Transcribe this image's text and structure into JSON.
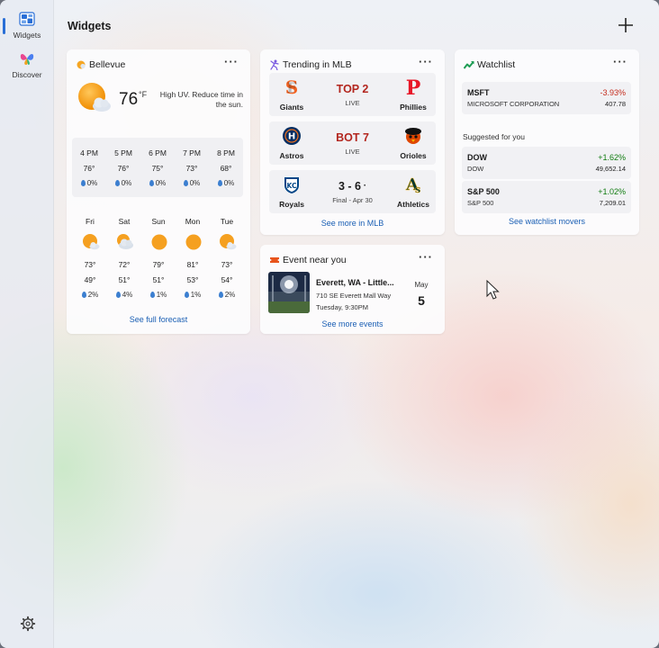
{
  "rail": {
    "widgets_label": "Widgets",
    "discover_label": "Discover"
  },
  "header": {
    "title": "Widgets"
  },
  "weather": {
    "location": "Bellevue",
    "temperature": "76",
    "unit": "°F",
    "description": "High UV. Reduce time in the sun.",
    "hourly": [
      {
        "time": "4 PM",
        "temp": "76°",
        "precip": "0%"
      },
      {
        "time": "5 PM",
        "temp": "76°",
        "precip": "0%"
      },
      {
        "time": "6 PM",
        "temp": "75°",
        "precip": "0%"
      },
      {
        "time": "7 PM",
        "temp": "73°",
        "precip": "0%"
      },
      {
        "time": "8 PM",
        "temp": "68°",
        "precip": "0%"
      }
    ],
    "daily": [
      {
        "day": "Fri",
        "icon": "partly-cloudy-icon",
        "high": "73°",
        "low": "49°",
        "precip": "2%"
      },
      {
        "day": "Sat",
        "icon": "cloudy-icon",
        "high": "72°",
        "low": "51°",
        "precip": "4%"
      },
      {
        "day": "Sun",
        "icon": "sunny-icon",
        "high": "79°",
        "low": "51°",
        "precip": "1%"
      },
      {
        "day": "Mon",
        "icon": "sunny-icon",
        "high": "81°",
        "low": "53°",
        "precip": "1%"
      },
      {
        "day": "Tue",
        "icon": "partly-cloudy-icon",
        "high": "73°",
        "low": "54°",
        "precip": "2%"
      }
    ],
    "link": "See full forecast"
  },
  "mlb": {
    "title": "Trending in MLB",
    "games": [
      {
        "away": "Giants",
        "home": "Phillies",
        "score": "TOP 2",
        "status": "LIVE",
        "live": true
      },
      {
        "away": "Astros",
        "home": "Orioles",
        "score": "BOT 7",
        "status": "LIVE",
        "live": true
      },
      {
        "away": "Royals",
        "home": "Athletics",
        "score": "3 - 6",
        "status": "Final - Apr 30",
        "live": false
      }
    ],
    "link": "See more in MLB"
  },
  "event": {
    "title": "Event near you",
    "name": "Everett, WA - Little...",
    "address": "710 SE Everett Mall Way",
    "time": "Tuesday, 9:30PM",
    "month": "May",
    "day": "5",
    "link": "See more events"
  },
  "watchlist": {
    "title": "Watchlist",
    "items": [
      {
        "symbol": "MSFT",
        "name": "MICROSOFT CORPORATION",
        "change": "-3.93%",
        "price": "407.78",
        "direction": "down"
      }
    ],
    "suggested_label": "Suggested for you",
    "suggested": [
      {
        "symbol": "DOW",
        "name": "DOW",
        "change": "+1.62%",
        "price": "49,652.14",
        "direction": "up"
      },
      {
        "symbol": "S&P 500",
        "name": "S&P 500",
        "change": "+1.02%",
        "price": "7,209.01",
        "direction": "up"
      }
    ],
    "link": "See watchlist movers"
  },
  "colors": {
    "accent": "#2a6fd6",
    "live_score": "#b3261e",
    "negative": "#c42b1c",
    "positive": "#0f7b0f",
    "link": "#1a5fb4"
  }
}
